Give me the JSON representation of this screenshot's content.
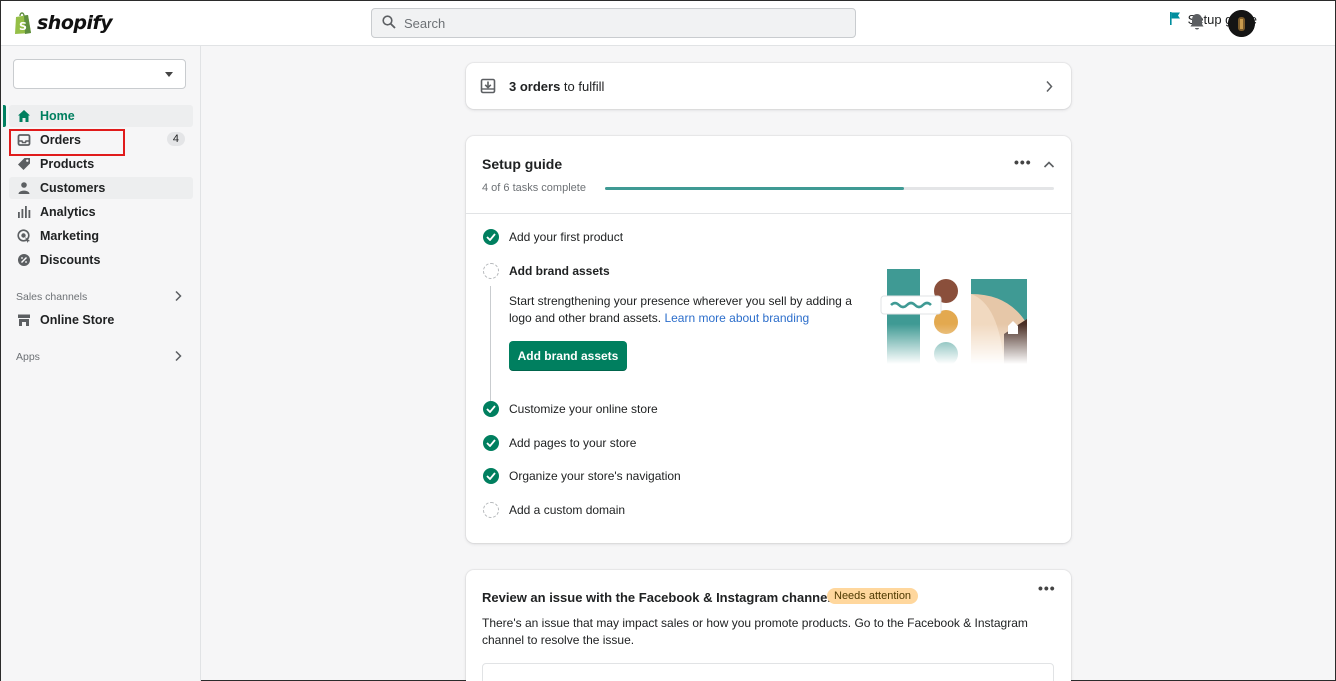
{
  "topbar": {
    "logo_text": "shopify",
    "search_placeholder": "Search",
    "setup_guide_label": "Setup guide"
  },
  "sidebar": {
    "store_selector_value": "",
    "items": [
      {
        "label": "Home",
        "icon": "home-icon"
      },
      {
        "label": "Orders",
        "icon": "orders-icon",
        "badge": "4"
      },
      {
        "label": "Products",
        "icon": "tag-icon"
      },
      {
        "label": "Customers",
        "icon": "person-icon"
      },
      {
        "label": "Analytics",
        "icon": "bar-chart-icon"
      },
      {
        "label": "Marketing",
        "icon": "target-icon"
      },
      {
        "label": "Discounts",
        "icon": "discount-icon"
      }
    ],
    "sales_channels_label": "Sales channels",
    "online_store_label": "Online Store",
    "apps_label": "Apps"
  },
  "orders_card": {
    "count_text": "3 orders",
    "suffix_text": " to fulfill"
  },
  "setup_guide": {
    "title": "Setup guide",
    "progress_text": "4 of 6 tasks complete",
    "progress_fraction": 0.667,
    "tasks": [
      {
        "label": "Add your first product",
        "done": true
      },
      {
        "label": "Add brand assets",
        "done": false
      },
      {
        "label": "Customize your online store",
        "done": true
      },
      {
        "label": "Add pages to your store",
        "done": true
      },
      {
        "label": "Organize your store's navigation",
        "done": true
      },
      {
        "label": "Add a custom domain",
        "done": false
      }
    ],
    "brand_desc": "Start strengthening your presence wherever you sell by adding a logo and other brand assets.",
    "brand_link": "Learn more about branding",
    "brand_button": "Add brand assets"
  },
  "facebook_card": {
    "title": "Review an issue with the Facebook & Instagram channel",
    "badge": "Needs attention",
    "description": "There's an issue that may impact sales or how you promote products. Go to the Facebook & Instagram channel to resolve the issue."
  },
  "colors": {
    "accent": "#007f5f",
    "progress": "#3f9a94",
    "highlight_box": "#e01b1b",
    "badge_attention": "#ffd79d"
  }
}
